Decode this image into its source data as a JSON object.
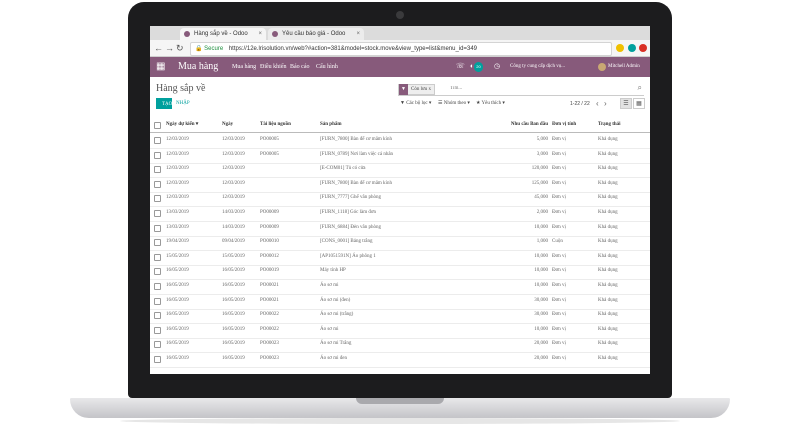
{
  "browser": {
    "tabs": [
      {
        "label": "Hàng sắp về - Odoo",
        "active": true
      },
      {
        "label": "Yêu cầu báo giá - Odoo",
        "active": false
      }
    ],
    "secure_label": "Secure",
    "url": "https://12e.lrisolution.vn/web?#action=381&model=stock.move&view_type=list&menu_id=349"
  },
  "odoo": {
    "app_name": "Mua hàng",
    "menu": [
      "Mua hàng",
      "Điều khiển",
      "Báo cáo",
      "Cấu hình"
    ],
    "badge_count": "20",
    "company": "Công ty cung cấp dịch vụ...",
    "user": "Mitchell Admin"
  },
  "control": {
    "breadcrumb": "Hàng sắp về",
    "facet_label": "Còn lưu",
    "facet_remove": "x",
    "search_placeholder": "Tìm...",
    "create_label": "TẠO",
    "import_label": "NHẬP",
    "filters_label": "Các bộ lọc",
    "groupby_label": "Nhóm theo",
    "favorites_label": "Yêu thích",
    "pager": "1-22 / 22"
  },
  "table": {
    "headers": [
      "Ngày dự kiến ▾",
      "Ngày",
      "Tài liệu nguồn",
      "Sản phẩm",
      "Nhu cầu Ban đầu",
      "Đơn vị tính",
      "Trạng thái"
    ],
    "rows": [
      [
        "12/03/2019",
        "12/03/2019",
        "PO00005",
        "[FURN_7800] Bàn để cơ mâm kính",
        "5,000",
        "Đơn vị",
        "Khả dụng"
      ],
      [
        "12/03/2019",
        "12/03/2019",
        "PO00005",
        "[FURN_0789] Nơi làm việc cá nhân",
        "3,000",
        "Đơn vị",
        "Khả dụng"
      ],
      [
        "12/03/2019",
        "12/03/2019",
        "",
        "[E-COM01] Tủ có cửa",
        "120,000",
        "Đơn vị",
        "Khả dụng"
      ],
      [
        "12/03/2019",
        "12/03/2019",
        "",
        "[FURN_7800] Bàn để cơ mâm kính",
        "125,000",
        "Đơn vị",
        "Khả dụng"
      ],
      [
        "12/03/2019",
        "12/03/2019",
        "",
        "[FURN_7777] Ghế văn phòng",
        "45,000",
        "Đơn vị",
        "Khả dụng"
      ],
      [
        "13/03/2019",
        "14/03/2019",
        "PO00009",
        "[FURN_1118] Góc làm đơn",
        "2,000",
        "Đơn vị",
        "Khả dụng"
      ],
      [
        "13/03/2019",
        "14/03/2019",
        "PO00009",
        "[FURN_6884] Đèn văn phòng",
        "10,000",
        "Đơn vị",
        "Khả dụng"
      ],
      [
        "19/04/2019",
        "09/04/2019",
        "PO00010",
        "[CONS_0001] Bảng trắng",
        "1,000",
        "Cuộn",
        "Khả dụng"
      ],
      [
        "15/05/2019",
        "15/05/2019",
        "PO00012",
        "[AP1051591N] Áo phông 1",
        "10,000",
        "Đơn vị",
        "Khả dụng"
      ],
      [
        "16/05/2019",
        "16/05/2019",
        "PO00019",
        "Máy tính HP",
        "10,000",
        "Đơn vị",
        "Khả dụng"
      ],
      [
        "16/05/2019",
        "16/05/2019",
        "PO00021",
        "Áo sơ mi",
        "10,000",
        "Đơn vị",
        "Khả dụng"
      ],
      [
        "16/05/2019",
        "16/05/2019",
        "PO00021",
        "Áo sơ mi (đen)",
        "30,000",
        "Đơn vị",
        "Khả dụng"
      ],
      [
        "16/05/2019",
        "16/05/2019",
        "PO00022",
        "Áo sơ mi (trắng)",
        "30,000",
        "Đơn vị",
        "Khả dụng"
      ],
      [
        "16/05/2019",
        "16/05/2019",
        "PO00022",
        "Áo sơ mi",
        "10,000",
        "Đơn vị",
        "Khả dụng"
      ],
      [
        "16/05/2019",
        "16/05/2019",
        "PO00023",
        "Áo sơ mi Trắng",
        "20,000",
        "Đơn vị",
        "Khả dụng"
      ],
      [
        "16/05/2019",
        "16/05/2019",
        "PO00023",
        "Áo sơ mi đen",
        "20,000",
        "Đơn vị",
        "Khả dụng"
      ]
    ]
  },
  "colors": {
    "brand": "#875a7b",
    "accent": "#00a09d"
  },
  "icons": [
    "apps-grid-icon",
    "search-icon",
    "funnel-icon",
    "list-view-icon",
    "kanban-view-icon",
    "phone-icon",
    "chat-icon",
    "lock-icon"
  ]
}
